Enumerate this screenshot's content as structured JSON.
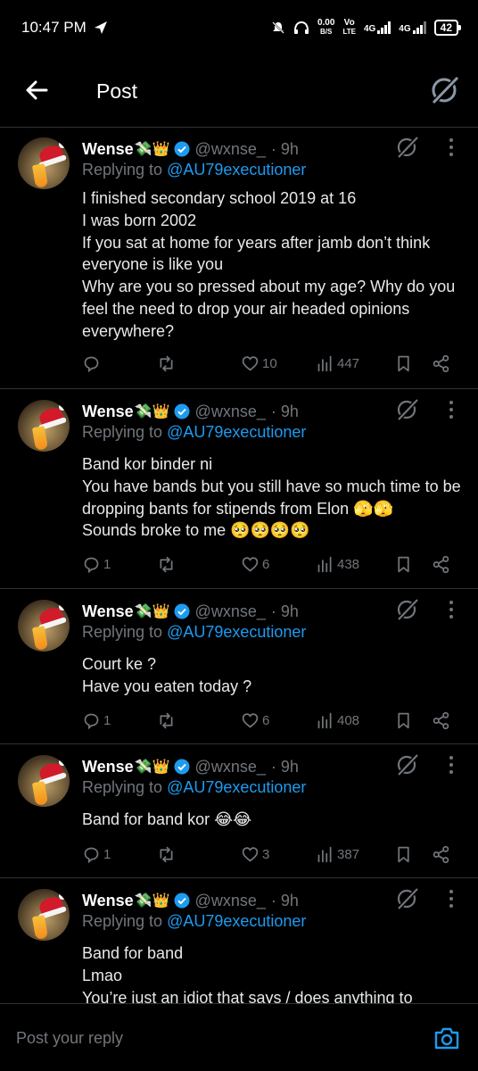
{
  "status_bar": {
    "time": "10:47 PM",
    "net_speed_value": "0.00",
    "net_speed_unit": "B/S",
    "volte_top": "Vo",
    "volte_bottom": "LTE",
    "net1": "4G",
    "net2": "4G",
    "battery": "42",
    "icons": [
      "send-icon",
      "mute-icon",
      "headset-icon",
      "signal-icon",
      "battery-icon"
    ]
  },
  "header": {
    "title": "Post",
    "back_icon": "arrow-left-icon",
    "grok_icon": "grok-icon"
  },
  "tweets": [
    {
      "name": "Wense",
      "emoji": "💸👑",
      "handle": "@wxnse_",
      "time": "· 9h",
      "replying_prefix": "Replying to ",
      "replying_to": "@AU79executioner",
      "text": "I finished secondary school 2019 at 16\nI was born 2002\nIf you sat at home for years after jamb don’t think everyone is like you\nWhy are you so pressed about my age? Why do you feel the need to drop your air headed opinions everywhere?",
      "replies": "",
      "likes": "10",
      "views": "447"
    },
    {
      "name": "Wense",
      "emoji": "💸👑",
      "handle": "@wxnse_",
      "time": "· 9h",
      "replying_prefix": "Replying to ",
      "replying_to": "@AU79executioner",
      "text": "Band kor binder ni\nYou have bands but you still have so much time to be dropping bants for stipends from Elon 🫣🫣\nSounds broke to me 🥺🥺🥺🥺",
      "replies": "1",
      "likes": "6",
      "views": "438"
    },
    {
      "name": "Wense",
      "emoji": "💸👑",
      "handle": "@wxnse_",
      "time": "· 9h",
      "replying_prefix": "Replying to ",
      "replying_to": "@AU79executioner",
      "text": "Court ke ?\nHave you eaten today ?",
      "replies": "1",
      "likes": "6",
      "views": "408"
    },
    {
      "name": "Wense",
      "emoji": "💸👑",
      "handle": "@wxnse_",
      "time": "· 9h",
      "replying_prefix": "Replying to ",
      "replying_to": "@AU79executioner",
      "text": "Band for band kor 😂😂",
      "replies": "1",
      "likes": "3",
      "views": "387"
    },
    {
      "name": "Wense",
      "emoji": "💸👑",
      "handle": "@wxnse_",
      "time": "· 9h",
      "replying_prefix": "Replying to ",
      "replying_to": "@AU79executioner",
      "text": "Band for band\nLmao\nYou’re just an idiot that says / does anything to",
      "replies": "",
      "likes": "",
      "views": ""
    }
  ],
  "reply_bar": {
    "placeholder": "Post your reply",
    "camera_icon": "camera-icon"
  },
  "colors": {
    "background": "#000000",
    "text": "#e7e9ea",
    "muted": "#71767b",
    "accent": "#1d9bf0",
    "divider": "#2f3336"
  }
}
